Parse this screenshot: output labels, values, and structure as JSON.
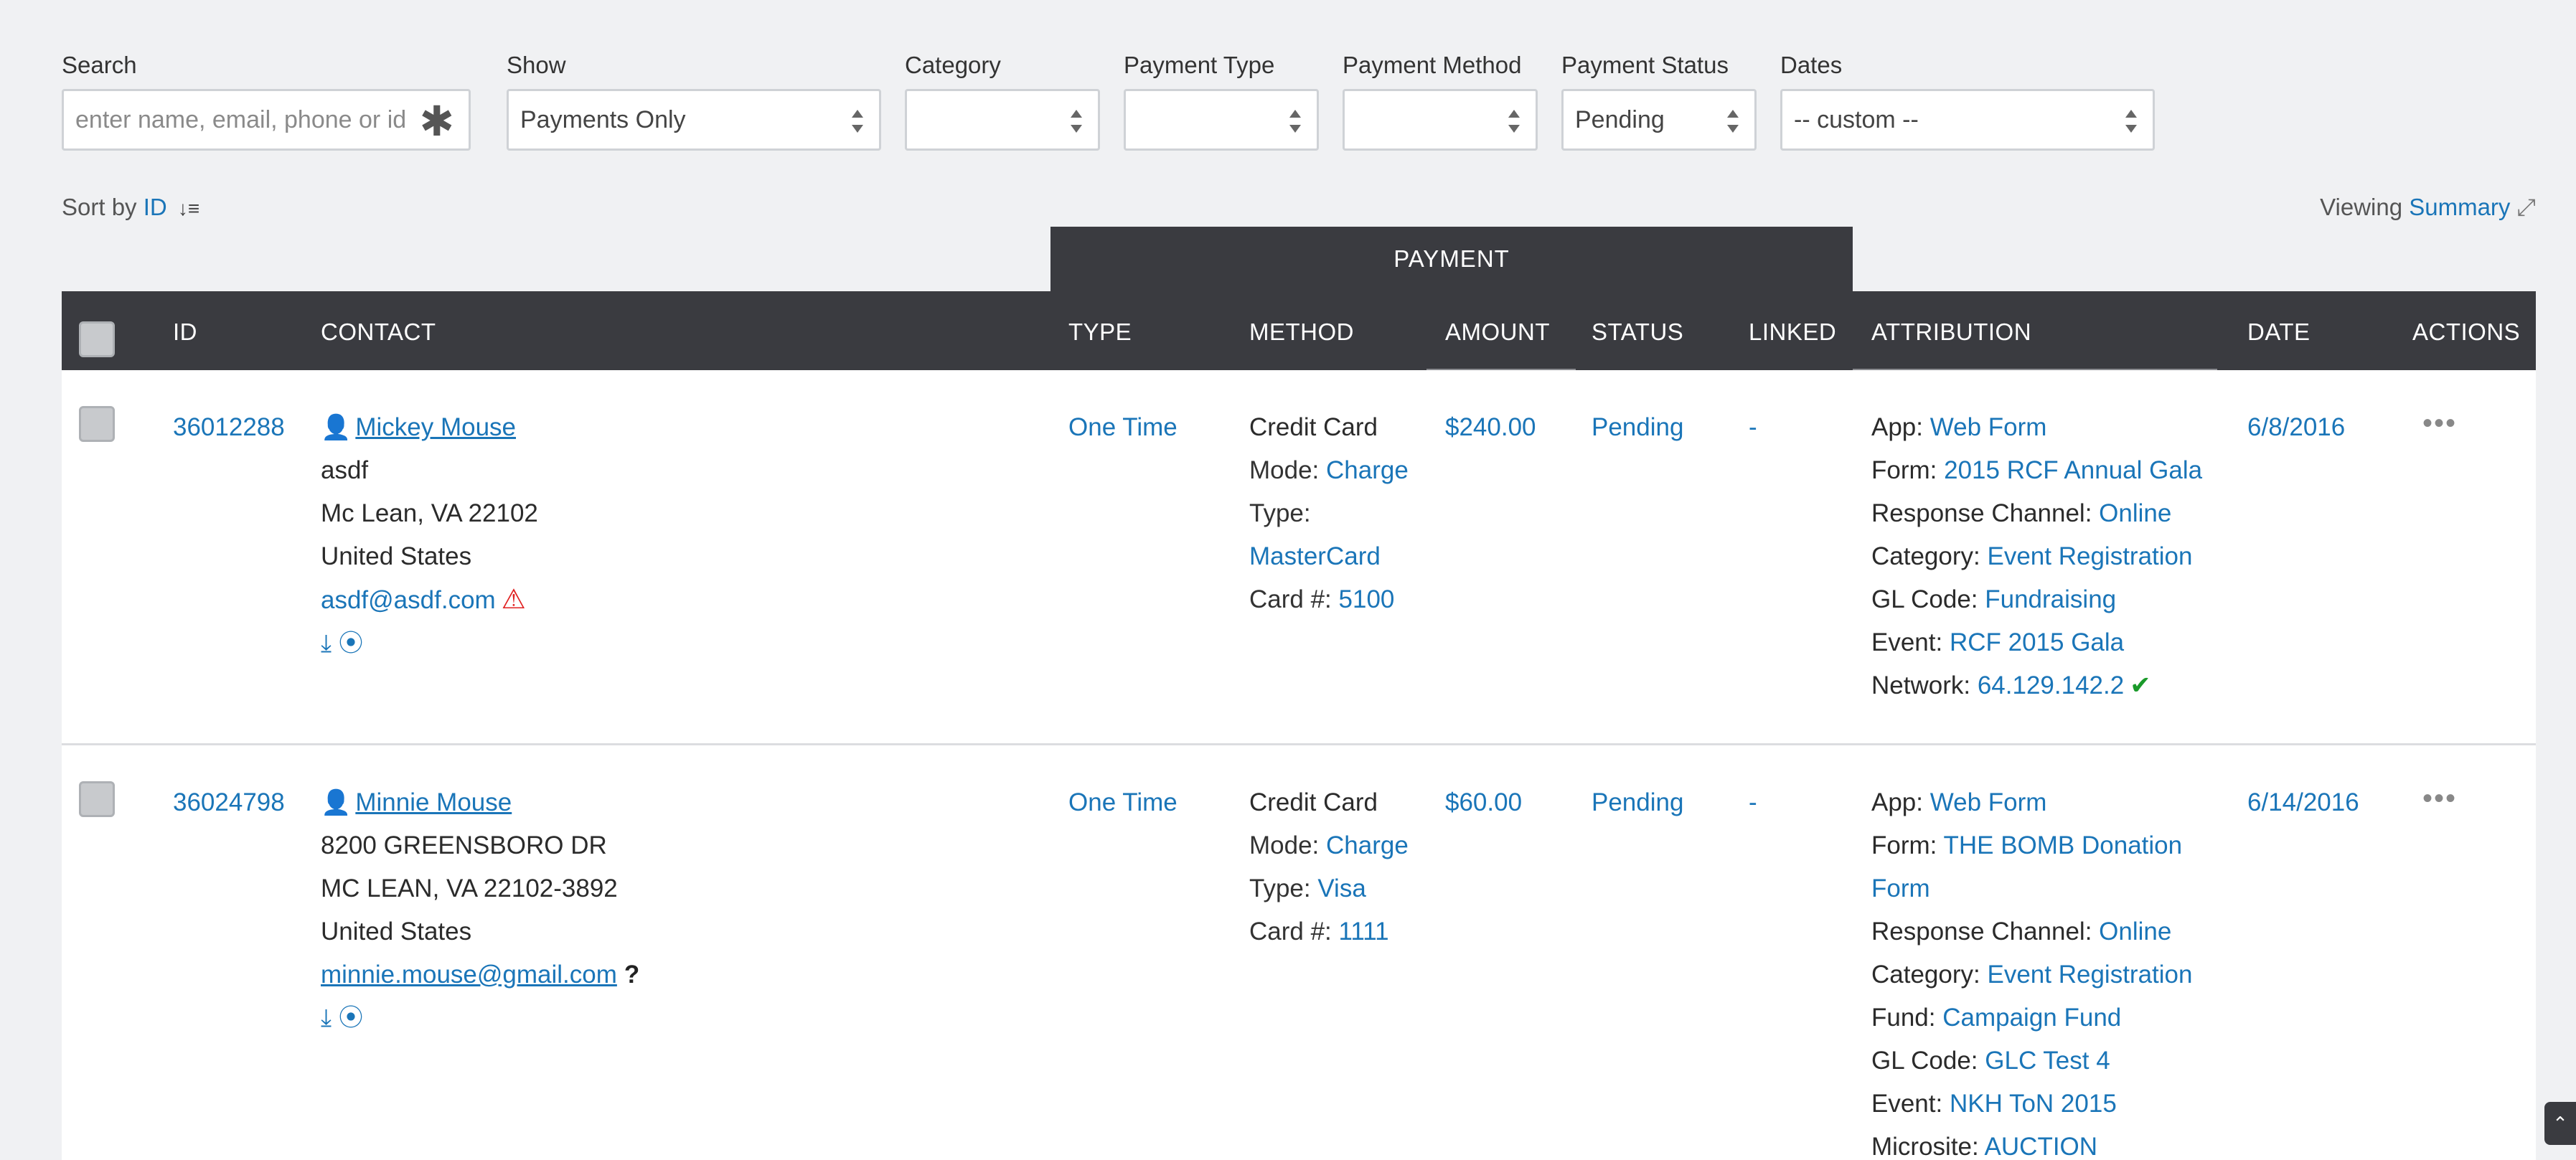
{
  "filters": {
    "search": {
      "label": "Search",
      "placeholder": "enter name, email, phone or id"
    },
    "show": {
      "label": "Show",
      "value": "Payments Only"
    },
    "category": {
      "label": "Category",
      "value": ""
    },
    "payment_type": {
      "label": "Payment Type",
      "value": ""
    },
    "payment_method": {
      "label": "Payment Method",
      "value": ""
    },
    "payment_status": {
      "label": "Payment Status",
      "value": "Pending"
    },
    "dates": {
      "label": "Dates",
      "value": "-- custom --"
    }
  },
  "sort": {
    "prefix": "Sort by",
    "field": "ID"
  },
  "viewing": {
    "prefix": "Viewing",
    "mode": "Summary"
  },
  "table": {
    "group_header": "PAYMENT",
    "columns": {
      "id": "ID",
      "contact": "CONTACT",
      "type": "TYPE",
      "method": "METHOD",
      "amount": "AMOUNT",
      "status": "STATUS",
      "linked": "LINKED",
      "attribution": "ATTRIBUTION",
      "date": "DATE",
      "actions": "ACTIONS"
    },
    "rows": [
      {
        "id": "36012288",
        "contact": {
          "name": "Mickey Mouse",
          "line1": "asdf",
          "line2": "Mc Lean, VA 22102",
          "line3": "United States",
          "email": "asdf@asdf.com"
        },
        "type": "One Time",
        "method": {
          "name": "Credit Card",
          "mode_label": "Mode:",
          "mode": "Charge",
          "type_label": "Type:",
          "type": "MasterCard",
          "card_label": "Card #:",
          "card": "5100"
        },
        "amount": "$240.00",
        "status": "Pending",
        "linked": "-",
        "attribution": {
          "app_l": "App:",
          "app": "Web Form",
          "form_l": "Form:",
          "form": "2015 RCF Annual Gala",
          "rc_l": "Response Channel:",
          "rc": "Online",
          "cat_l": "Category:",
          "cat": "Event Registration",
          "gl_l": "GL Code:",
          "gl": "Fundraising",
          "event_l": "Event:",
          "event": "RCF 2015 Gala",
          "net_l": "Network:",
          "net": "64.129.142.2"
        },
        "date": "6/8/2016"
      },
      {
        "id": "36024798",
        "contact": {
          "name": "Minnie Mouse",
          "line1": "8200 GREENSBORO DR",
          "line2": "MC LEAN, VA 22102-3892",
          "line3": "United States",
          "email": "minnie.mouse@gmail.com"
        },
        "type": "One Time",
        "method": {
          "name": "Credit Card",
          "mode_label": "Mode:",
          "mode": "Charge",
          "type_label": "Type:",
          "type": "Visa",
          "card_label": "Card #:",
          "card": "1111"
        },
        "amount": "$60.00",
        "status": "Pending",
        "linked": "-",
        "attribution": {
          "app_l": "App:",
          "app": "Web Form",
          "form_l": "Form:",
          "form_a": "THE BOMB Donation",
          "form_b": "Form",
          "rc_l": "Response Channel:",
          "rc": "Online",
          "cat_l": "Category:",
          "cat": "Event Registration",
          "fund_l": "Fund:",
          "fund": "Campaign Fund",
          "gl_l": "GL Code:",
          "gl": "GLC Test 4",
          "event_l": "Event:",
          "event": "NKH ToN 2015",
          "ms_l": "Microsite:",
          "ms": "AUCTION"
        },
        "date": "6/14/2016"
      }
    ]
  }
}
